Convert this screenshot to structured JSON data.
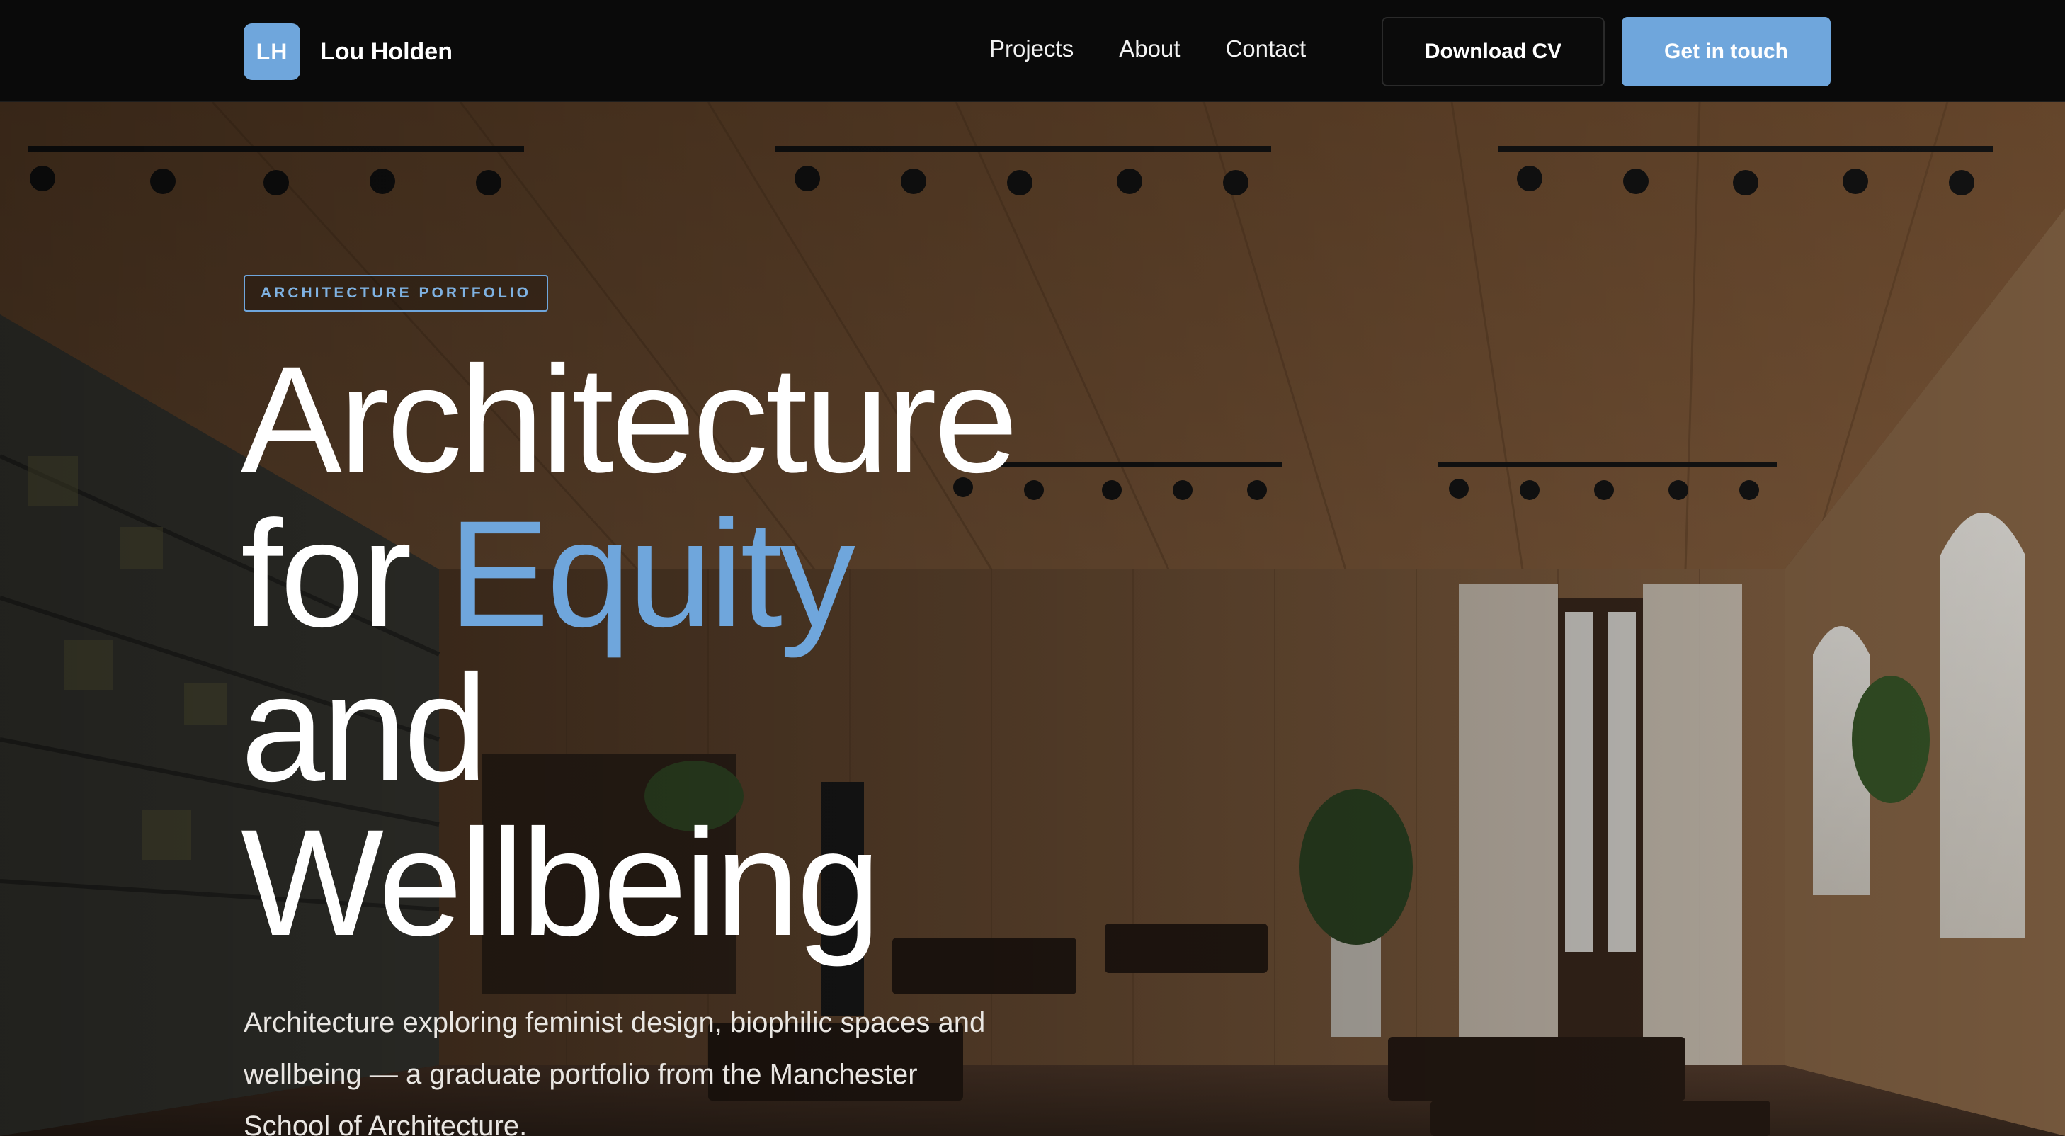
{
  "nav": {
    "logo_initials": "LH",
    "brand_name": "Lou Holden",
    "links": [
      {
        "label": "Projects"
      },
      {
        "label": "About"
      },
      {
        "label": "Contact"
      }
    ],
    "download_cv_label": "Download CV",
    "get_in_touch_label": "Get in touch"
  },
  "hero": {
    "badge": "ARCHITECTURE PORTFOLIO",
    "headline": {
      "line1": "Architecture",
      "line2_prefix": "for ",
      "line2_accent": "Equity",
      "line3": "and",
      "line4": "Wellbeing"
    },
    "lede": "Architecture exploring feminist design, biophilic spaces and wellbeing — a graduate portfolio from the Manchester School of Architecture."
  },
  "colors": {
    "accent": "#6fa6dc",
    "nav_background": "#0a0a0a",
    "text": "#ffffff"
  }
}
